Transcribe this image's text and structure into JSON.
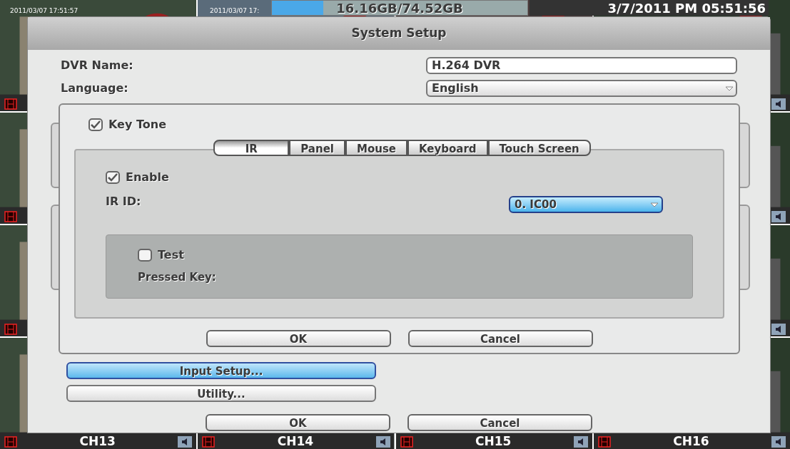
{
  "status_bar": {
    "timestamps": [
      "2011/03/07 17:51:57",
      "2011/03/07 17:"
    ],
    "storage": {
      "text": "16.16GB/74.52GB",
      "level": 0.2
    },
    "datetime": "3/7/2011 PM 05:51:56"
  },
  "channels": [
    {
      "label": "CH13"
    },
    {
      "label": "CH14"
    },
    {
      "label": "CH15"
    },
    {
      "label": "CH16"
    }
  ],
  "window": {
    "title": "System Setup"
  },
  "fields": [
    {
      "kind": "text",
      "label": "DVR Name:",
      "value": "H.264 DVR"
    },
    {
      "kind": "select",
      "label": "Language:",
      "value": "English"
    }
  ],
  "menu_buttons": [
    {
      "label": "Input Setup...",
      "selected": true
    },
    {
      "label": "Utility...",
      "selected": false
    }
  ],
  "buttons": [
    "OK",
    "Cancel"
  ],
  "input_dialog": {
    "key_tone": {
      "label": "Key Tone",
      "checked": true
    },
    "tabs": [
      {
        "label": "IR",
        "selected": true
      },
      {
        "label": "Panel",
        "selected": false
      },
      {
        "label": "Mouse",
        "selected": false
      },
      {
        "label": "Keyboard",
        "selected": false
      },
      {
        "label": "Touch Screen",
        "selected": false
      }
    ],
    "enable": {
      "label": "Enable",
      "checked": true
    },
    "ir_id": {
      "label": "IR ID:",
      "value": "0. IC00"
    },
    "test": {
      "label": "Test",
      "checked": false
    },
    "pressed_key": "Pressed Key:",
    "buttons": [
      "OK",
      "Cancel"
    ]
  }
}
